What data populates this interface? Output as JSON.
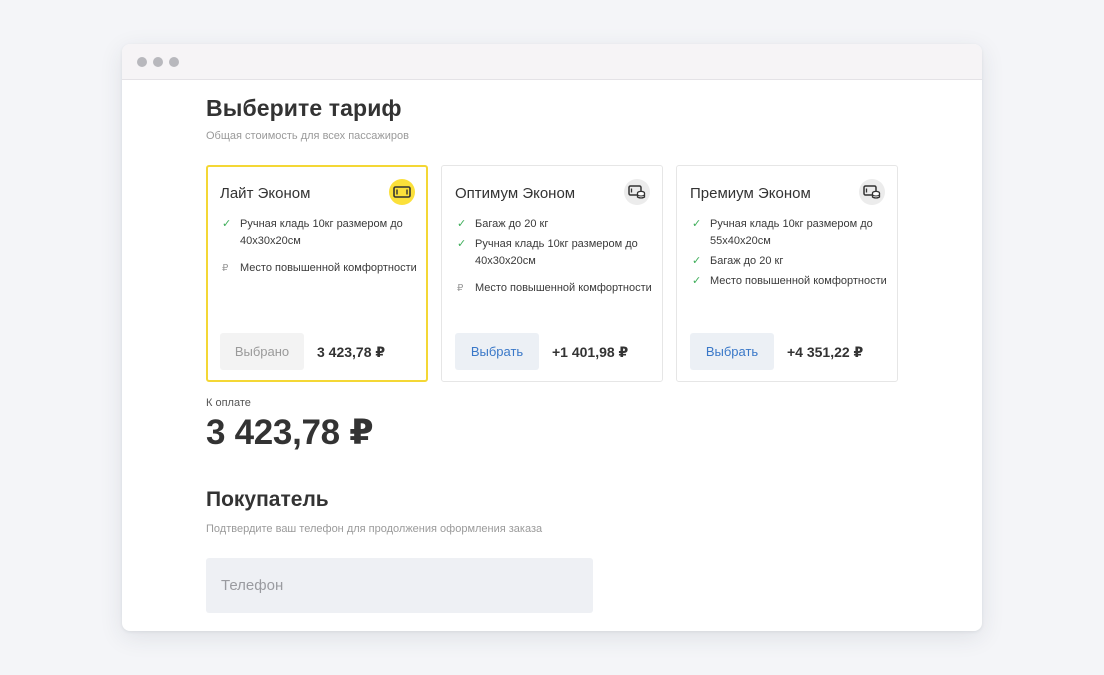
{
  "tariffs": {
    "title": "Выберите тариф",
    "subtitle": "Общая стоимость для всех пассажиров",
    "cards": [
      {
        "name": "Лайт Эконом",
        "icon": "ticket-icon",
        "selected": true,
        "features": [
          {
            "text": "Ручная кладь 10кг размером до 40x30x20см",
            "mark": "✓"
          },
          {
            "text": "Место повышенной комфортности",
            "mark": "₽"
          }
        ],
        "button_label": "Выбрано",
        "price": "3 423,78 ₽"
      },
      {
        "name": "Оптимум Эконом",
        "icon": "ticket-coins-icon",
        "selected": false,
        "features": [
          {
            "text": "Багаж до 20 кг",
            "mark": "✓"
          },
          {
            "text": "Ручная кладь 10кг размером до 40x30x20см",
            "mark": "✓"
          },
          {
            "text": "Место повышенной комфортности",
            "mark": "₽"
          }
        ],
        "button_label": "Выбрать",
        "price": "+1 401,98 ₽"
      },
      {
        "name": "Премиум Эконом",
        "icon": "ticket-coins-icon",
        "selected": false,
        "features": [
          {
            "text": "Ручная кладь 10кг размером до 55x40x20см",
            "mark": "✓"
          },
          {
            "text": "Багаж до 20 кг",
            "mark": "✓"
          },
          {
            "text": "Место повышенной комфортности",
            "mark": "✓"
          }
        ],
        "button_label": "Выбрать",
        "price": "+4 351,22 ₽"
      }
    ]
  },
  "payment": {
    "label": "К оплате",
    "total": "3 423,78 ₽"
  },
  "buyer": {
    "title": "Покупатель",
    "subtitle": "Подтвердите ваш телефон для продолжения оформления заказа",
    "phone_placeholder": "Телефон"
  },
  "colors": {
    "accent": "#f4d735",
    "check": "#3fae5a",
    "link": "#3a78c8",
    "button_bg": "#ecf0f5"
  }
}
